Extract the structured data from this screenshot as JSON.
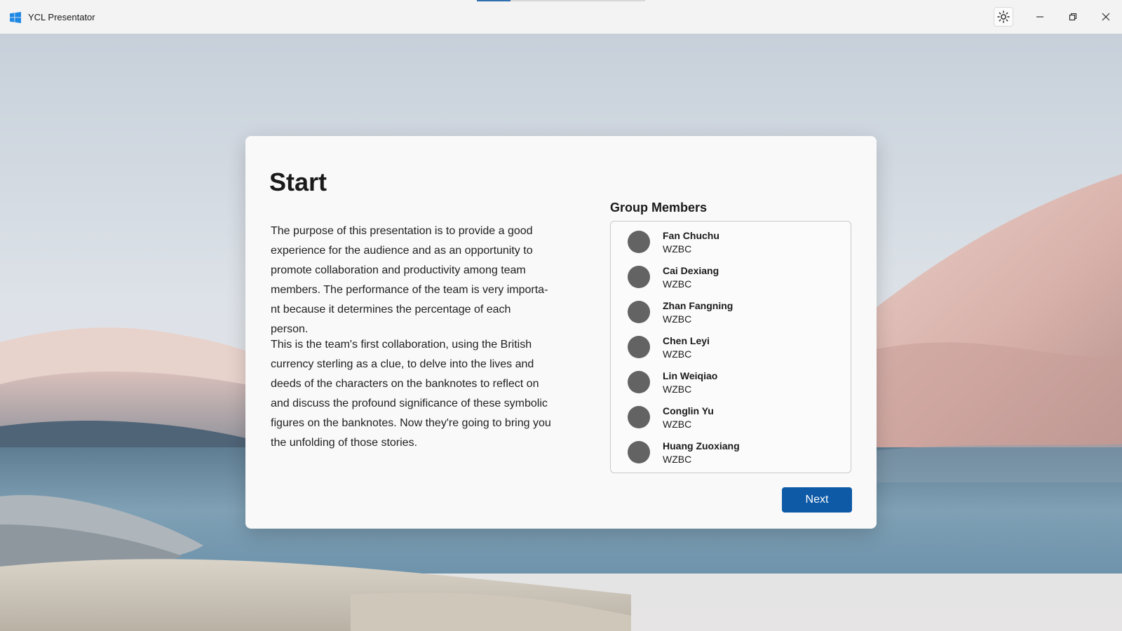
{
  "window": {
    "title": "YCL Presentator",
    "progress": 0.2,
    "icons": {
      "app": "windows-logo-icon",
      "theme": "sun-icon",
      "minimize": "minimize-icon",
      "maximize": "restore-icon",
      "close": "close-icon"
    }
  },
  "card": {
    "title": "Start",
    "paragraphs": [
      "The purpose of this presentation is to provide a good experience for the audience and as an opportunity to promote collaboration and productivity among team members. The performance of the team is very importa-nt because it determines the percentage of each person.",
      "This is the team's first collaboration, using the British currency sterling as a clue, to delve into the lives and deeds of the characters on the banknotes to reflect on and discuss the profound significance of these symbolic figures on the banknotes. Now they're going to bring you the unfolding of those stories."
    ],
    "members_title": "Group Members",
    "members": [
      {
        "name": "Fan Chuchu",
        "org": "WZBC"
      },
      {
        "name": "Cai Dexiang",
        "org": "WZBC"
      },
      {
        "name": "Zhan Fangning",
        "org": "WZBC"
      },
      {
        "name": "Chen Leyi",
        "org": "WZBC"
      },
      {
        "name": "Lin Weiqiao",
        "org": "WZBC"
      },
      {
        "name": "Conglin Yu",
        "org": "WZBC"
      },
      {
        "name": "Huang Zuoxiang",
        "org": "WZBC"
      }
    ],
    "next_label": "Next"
  },
  "colors": {
    "accent": "#0e5aa6",
    "avatar": "#636363",
    "titlebar": "#f3f3f3",
    "card": "#f9f9f9"
  }
}
